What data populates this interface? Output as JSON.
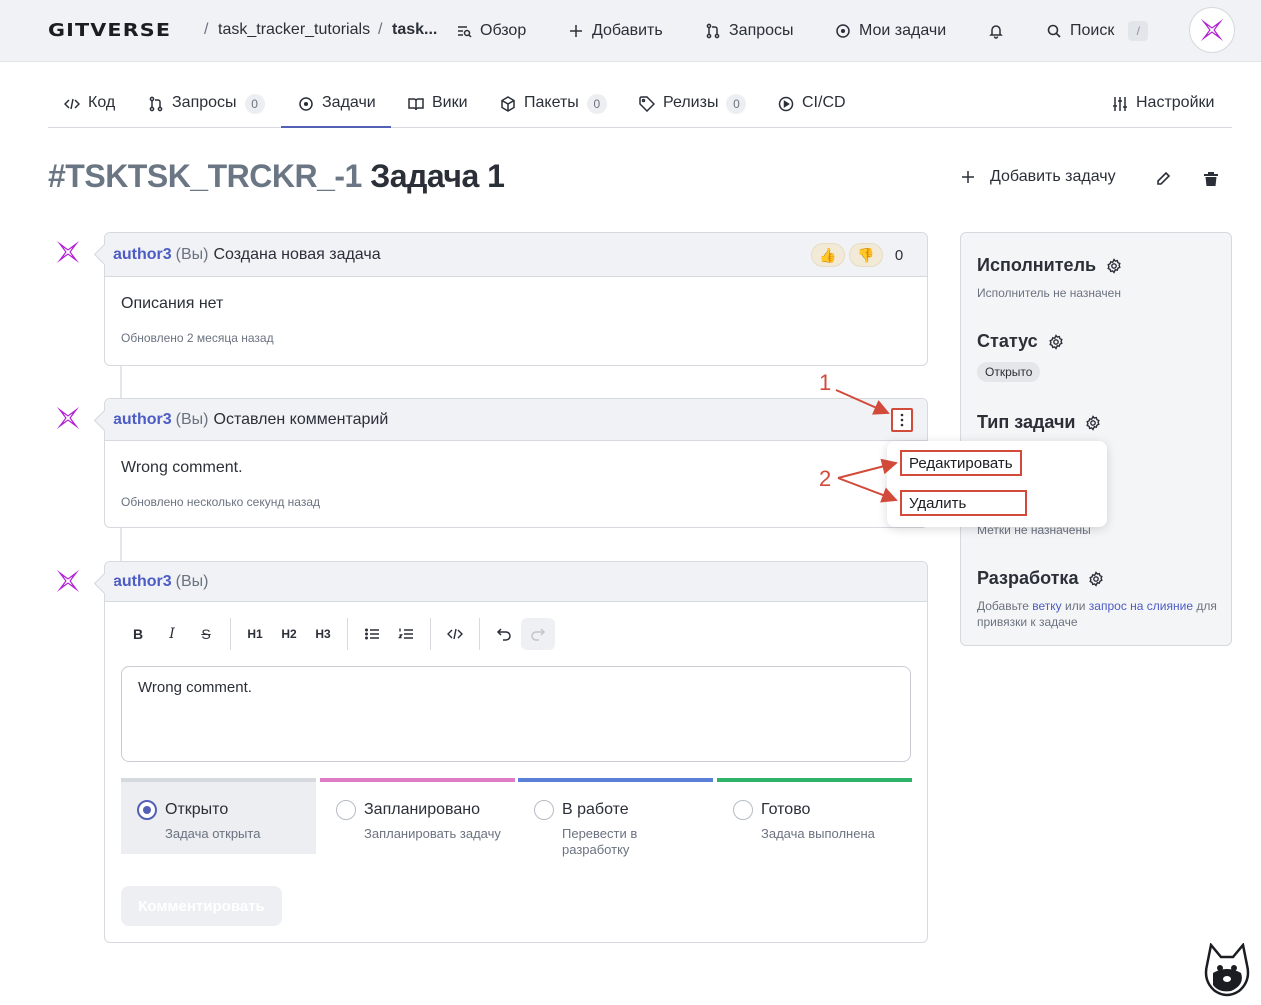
{
  "topbar": {
    "logo": "GITVERSE",
    "breadcrumb": [
      "task_tracker_tutorials",
      "task..."
    ],
    "separator": "/",
    "nav": {
      "overview": "Обзор",
      "add": "Добавить",
      "requests": "Запросы",
      "my_tasks": "Мои задачи",
      "search": "Поиск",
      "search_key": "/"
    }
  },
  "tabs": [
    {
      "label": "Код",
      "icon": "code-icon"
    },
    {
      "label": "Запросы",
      "icon": "pull-request-icon",
      "count": "0"
    },
    {
      "label": "Задачи",
      "icon": "issue-icon",
      "active": true
    },
    {
      "label": "Вики",
      "icon": "book-icon"
    },
    {
      "label": "Пакеты",
      "icon": "package-icon",
      "count": "0"
    },
    {
      "label": "Релизы",
      "icon": "tag-icon",
      "count": "0"
    },
    {
      "label": "CI/CD",
      "icon": "play-icon"
    },
    {
      "label": "Настройки",
      "icon": "sliders-icon"
    }
  ],
  "issue": {
    "number": "#TSKTSK_TRCKR_-1",
    "title": "Задача 1",
    "add_task": "Добавить задачу"
  },
  "timeline": [
    {
      "author": "author3",
      "you": "(Вы)",
      "action": "Создана новая задача",
      "body": "Описания нет",
      "meta": "Обновлено 2 месяца назад",
      "reactions": {
        "like": "👍",
        "dislike": "👎",
        "count": "0"
      }
    },
    {
      "author": "author3",
      "you": "(Вы)",
      "action": "Оставлен комментарий",
      "body": "Wrong comment.",
      "meta": "Обновлено несколько секунд назад"
    }
  ],
  "context_menu": {
    "edit": "Редактировать",
    "delete": "Удалить"
  },
  "annotations": {
    "one": "1",
    "two": "2",
    "color": "#d24a3a"
  },
  "composer": {
    "author": "author3",
    "you": "(Вы)",
    "toolbar": [
      "B",
      "I",
      "S",
      "H1",
      "H2",
      "H3"
    ],
    "text": "Wrong comment.",
    "statuses": [
      {
        "label": "Открыто",
        "desc": "Задача открыта",
        "color": "#d6d9de",
        "selected": true
      },
      {
        "label": "Запланировано",
        "desc": "Запланировать задачу",
        "color": "#e07cc4"
      },
      {
        "label": "В работе",
        "desc": "Перевести в разработку",
        "color": "#5a7fd6"
      },
      {
        "label": "Готово",
        "desc": "Задача выполнена",
        "color": "#2fb36b"
      }
    ],
    "submit": "Комментировать"
  },
  "sidebar": {
    "assignee": "Исполнитель",
    "assignee_sub": "Исполнитель не назначен",
    "status": "Статус",
    "status_value": "Открыто",
    "type": "Тип задачи",
    "labels_sub": "Метки не назначены",
    "dev": "Разработка",
    "dev_sub_1": "Добавьте",
    "dev_link_branch": "ветку",
    "dev_sub_2": "или",
    "dev_link_pr": "запрос на слияние",
    "dev_sub_3": "для привязки к задаче"
  }
}
